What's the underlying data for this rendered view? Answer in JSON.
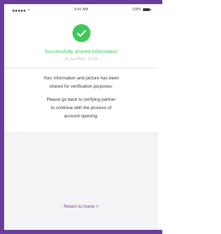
{
  "status_bar": {
    "time": "9:41 AM",
    "battery": "100%"
  },
  "success": {
    "title": "Successfully shared Information",
    "date": "02 Jul 2018 - 12:33"
  },
  "message": {
    "line1": "Your information and picture has been",
    "line2": "shared for verification purposes.",
    "line3": "Please go back to verifying partner",
    "line4": "to continue with the process of",
    "line5": "account opening."
  },
  "actions": {
    "return_label": "Return to home >"
  },
  "colors": {
    "accent_purple": "#6a3d9a",
    "success_green": "#3ec95a"
  }
}
